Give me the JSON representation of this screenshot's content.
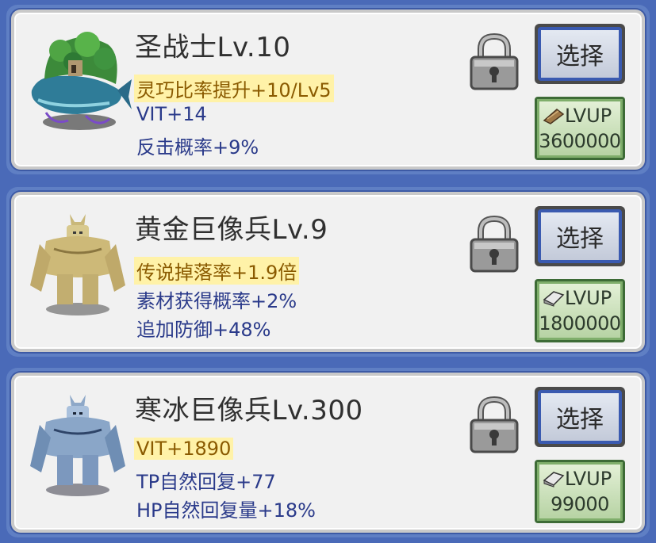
{
  "select_label": "选择",
  "lvup_label": "LVUP",
  "units": [
    {
      "name": "圣战士Lv.10",
      "highlight_stat": "灵巧比率提升+10/Lv5",
      "stats": [
        "VIT+14",
        "反击概率+9%"
      ],
      "lvup_cost": "3600000",
      "material_icon": "wood-icon"
    },
    {
      "name": "黄金巨像兵Lv.9",
      "highlight_stat": "传说掉落率+1.9倍",
      "stats": [
        "素材获得概率+2%",
        "追加防御+48%"
      ],
      "lvup_cost": "1800000",
      "material_icon": "iron-ingot-icon"
    },
    {
      "name": "寒冰巨像兵Lv.300",
      "highlight_stat": "VIT+1890",
      "stats": [
        "TP自然回复+77",
        "HP自然回复量+18%"
      ],
      "lvup_cost": "99000",
      "material_icon": "iron-ingot-icon"
    }
  ],
  "colors": {
    "background": "#4a6ab8",
    "highlight_bg": "#fff2a8",
    "stat_text": "#2a3a8a",
    "select_border": "#3a5ab0",
    "lvup_bg": "#b7d3a4"
  }
}
